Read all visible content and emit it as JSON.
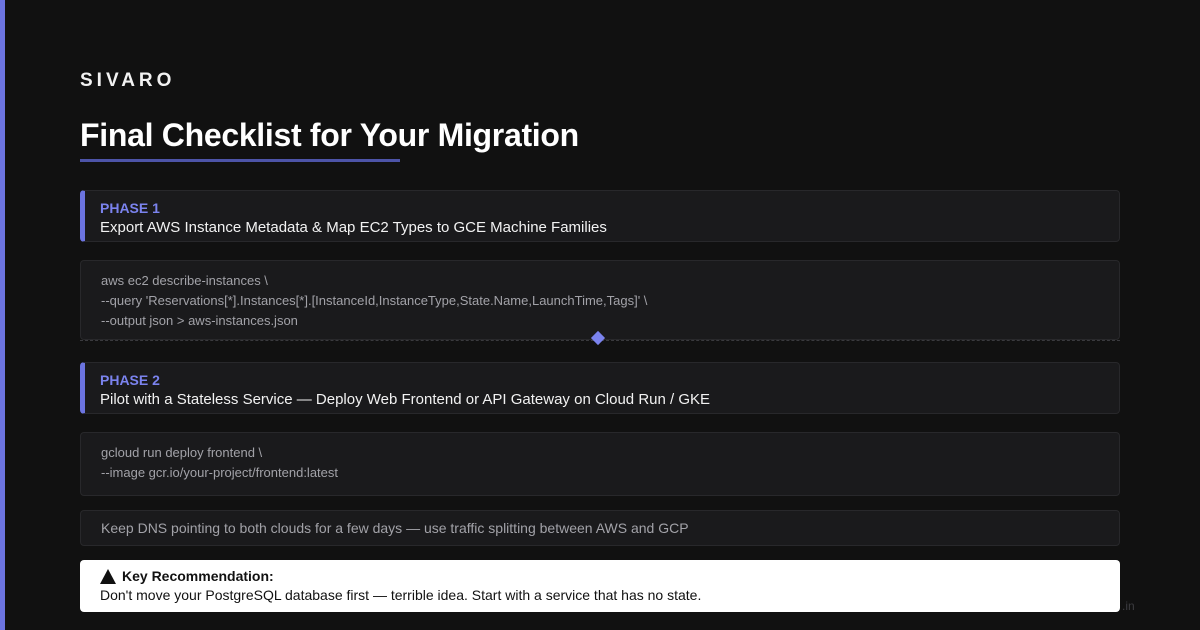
{
  "brand": "SIVARO",
  "title": "Final Checklist for Your Migration",
  "phases": [
    {
      "label": "PHASE 1",
      "text": "Export AWS Instance Metadata & Map EC2 Types to GCE Machine Families",
      "code": [
        "aws ec2 describe-instances \\",
        "--query 'Reservations[*].Instances[*].[InstanceId,InstanceType,State.Name,LaunchTime,Tags]' \\",
        "--output json > aws-instances.json"
      ]
    },
    {
      "label": "PHASE 2",
      "text": "Pilot with a Stateless Service — Deploy Web Frontend or API Gateway on Cloud Run / GKE",
      "code": [
        "gcloud run deploy frontend \\",
        "--image gcr.io/your-project/frontend:latest"
      ]
    }
  ],
  "note": "Keep DNS pointing to both clouds for a few days — use traffic splitting between AWS and GCP",
  "recommendation": {
    "heading": "Key Recommendation:",
    "body": "Don't move your PostgreSQL database first — terrible idea. Start with a service that has no state."
  },
  "watermark": ".in",
  "colors": {
    "accent": "#6c74e0",
    "phase_label": "#7b83ee",
    "background": "#111111"
  }
}
